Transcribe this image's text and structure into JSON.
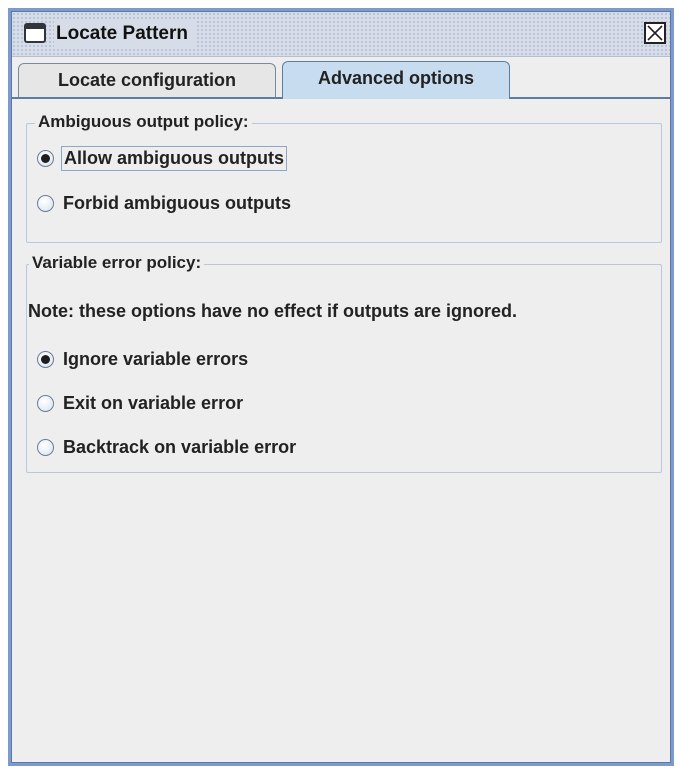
{
  "window": {
    "title": "Locate Pattern"
  },
  "tabs": [
    {
      "label": "Locate configuration",
      "selected": false
    },
    {
      "label": "Advanced options",
      "selected": true
    }
  ],
  "ambiguous_policy": {
    "title": "Ambiguous output policy:",
    "options": [
      {
        "label": "Allow ambiguous outputs",
        "selected": true
      },
      {
        "label": "Forbid ambiguous outputs",
        "selected": false
      }
    ]
  },
  "variable_error_policy": {
    "title": "Variable error policy:",
    "note": "Note: these options have no effect if outputs are ignored.",
    "options": [
      {
        "label": "Ignore variable errors",
        "selected": true
      },
      {
        "label": "Exit on variable error",
        "selected": false
      },
      {
        "label": "Backtrack on variable error",
        "selected": false
      }
    ]
  },
  "colors": {
    "window_border": "#7c9acc",
    "active_tab": "#c8dcf0",
    "panel_background": "#eeeeee"
  }
}
